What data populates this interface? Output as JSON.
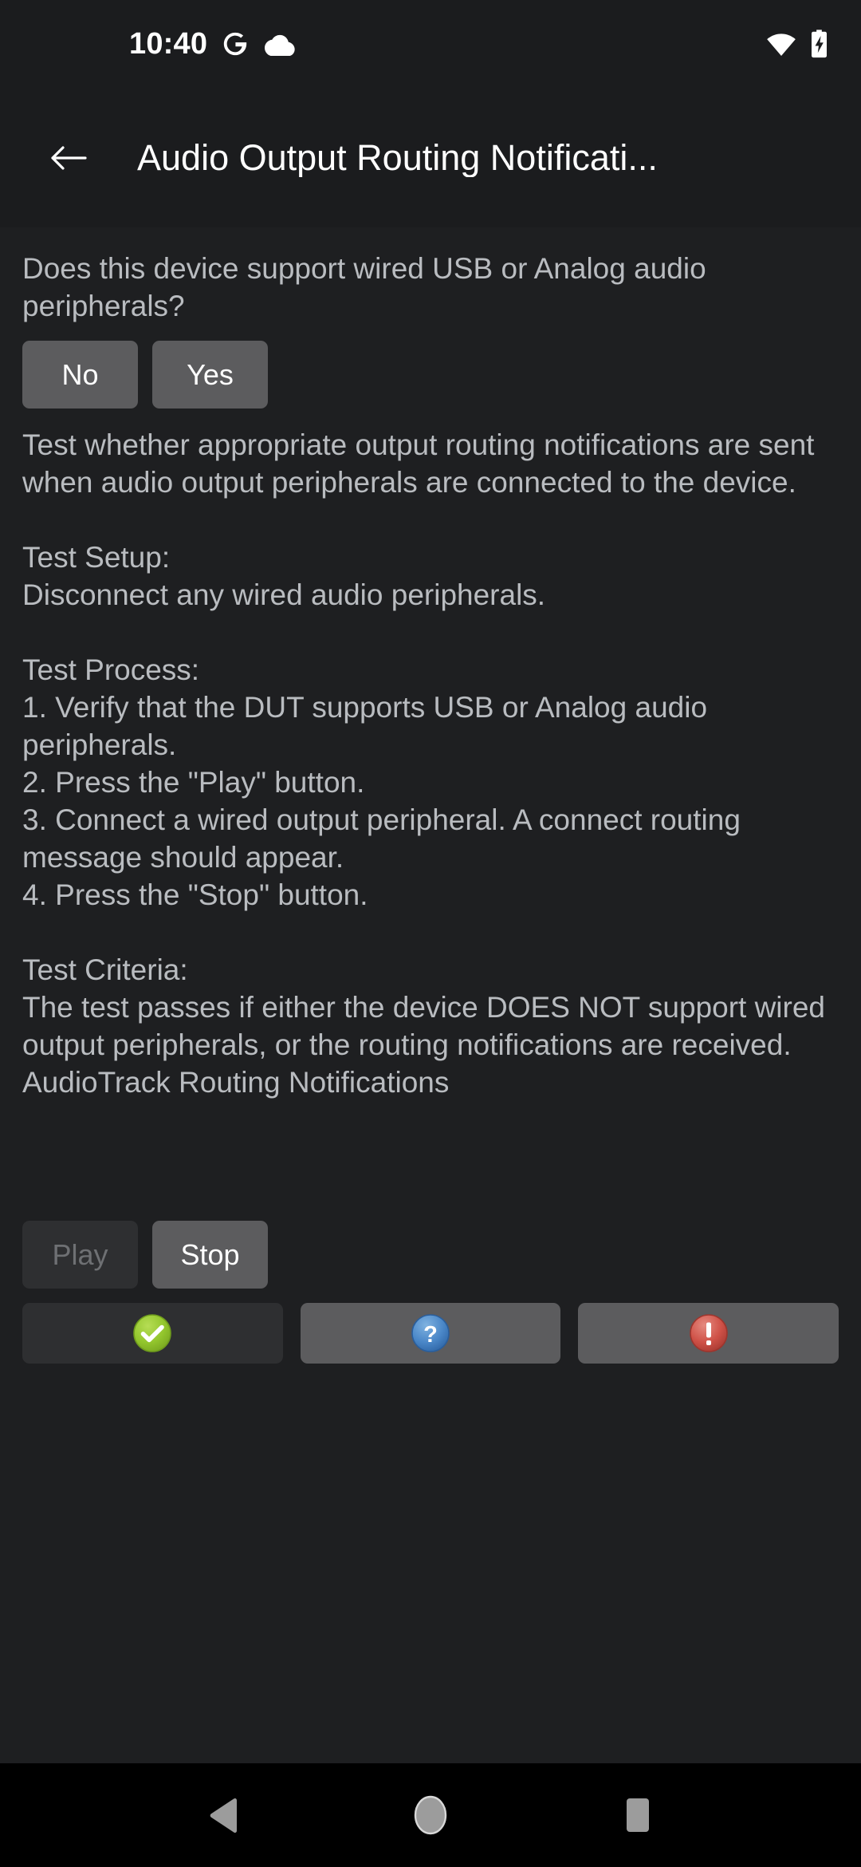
{
  "status_bar": {
    "time": "10:40",
    "icons": [
      "google-g-icon",
      "cloud-icon",
      "wifi-icon",
      "battery-charging-icon"
    ]
  },
  "app_bar": {
    "back_icon": "back-arrow-icon",
    "title": "Audio Output Routing Notificati..."
  },
  "content": {
    "question": "Does this device support wired USB or Analog audio peripherals?",
    "answer_buttons": [
      {
        "label": "No",
        "enabled": true
      },
      {
        "label": "Yes",
        "enabled": true
      }
    ],
    "instructions": "Test whether appropriate output routing notifications are sent when audio output peripherals are connected to the device.\n\nTest Setup:\nDisconnect any wired audio peripherals.\n\nTest Process:\n1. Verify that the DUT supports USB or Analog audio peripherals.\n2. Press the \"Play\" button.\n3. Connect a wired output peripheral. A connect routing message should appear.\n4. Press the \"Stop\" button.\n\nTest Criteria:\nThe test passes if either the device DOES NOT support wired output peripherals, or the routing notifications are received.",
    "routing_status": "AudioTrack Routing Notifications",
    "transport_buttons": [
      {
        "label": "Play",
        "enabled": false
      },
      {
        "label": "Stop",
        "enabled": true
      }
    ],
    "verdict_buttons": [
      {
        "icon": "pass-check-icon",
        "enabled": false,
        "color": "#8ec327"
      },
      {
        "icon": "info-question-icon",
        "enabled": true,
        "color": "#4a87c8"
      },
      {
        "icon": "fail-exclamation-icon",
        "enabled": true,
        "color": "#cf5147"
      }
    ]
  },
  "nav_bar": {
    "buttons": [
      {
        "name": "back",
        "icon": "nav-back-triangle-icon"
      },
      {
        "name": "home",
        "icon": "nav-home-circle-icon"
      },
      {
        "name": "recents",
        "icon": "nav-recents-square-icon"
      }
    ]
  },
  "colors": {
    "background": "#1e1f21",
    "app_bar": "#1b1c1e",
    "text": "#b9bcc0",
    "title": "#ffffff",
    "button": "#5c5c5e",
    "button_disabled": "#2e2f31",
    "nav_bar": "#000000",
    "nav_glyph": "#9c9c9c"
  }
}
